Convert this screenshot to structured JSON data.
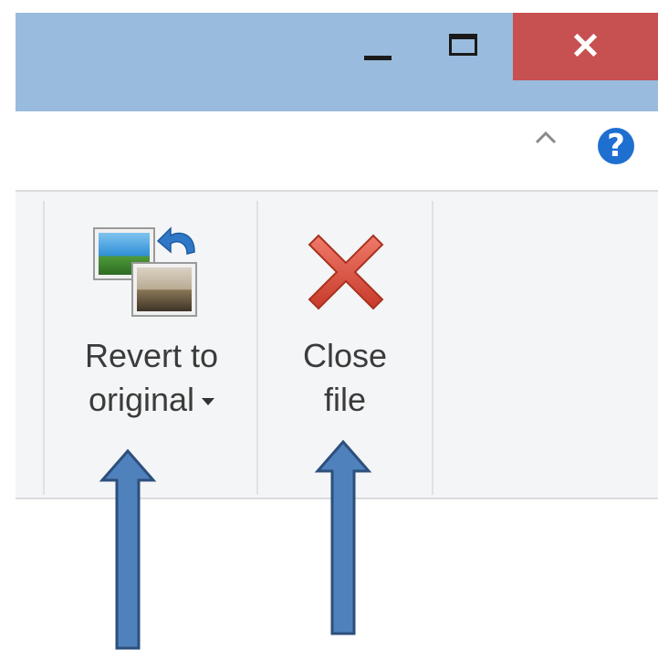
{
  "window": {
    "minimize_icon": "minimize-icon",
    "maximize_icon": "maximize-icon",
    "close_glyph": "✕"
  },
  "ribbon": {
    "collapse_icon": "chevron-up-icon",
    "help_glyph": "?",
    "commands": [
      {
        "label_line1": "Revert to",
        "label_line2": "original",
        "icon": "revert-image-icon",
        "has_dropdown": true
      },
      {
        "label_line1": "Close",
        "label_line2": "file",
        "icon": "red-x-icon",
        "has_dropdown": false
      }
    ]
  },
  "annotations": {
    "arrow_color": "#4f81bd",
    "arrow_count": 2
  },
  "colors": {
    "titlebar": "#99bbdd",
    "close_button": "#c75050",
    "ribbon_body": "#f4f5f7",
    "help": "#1e6fd0"
  }
}
